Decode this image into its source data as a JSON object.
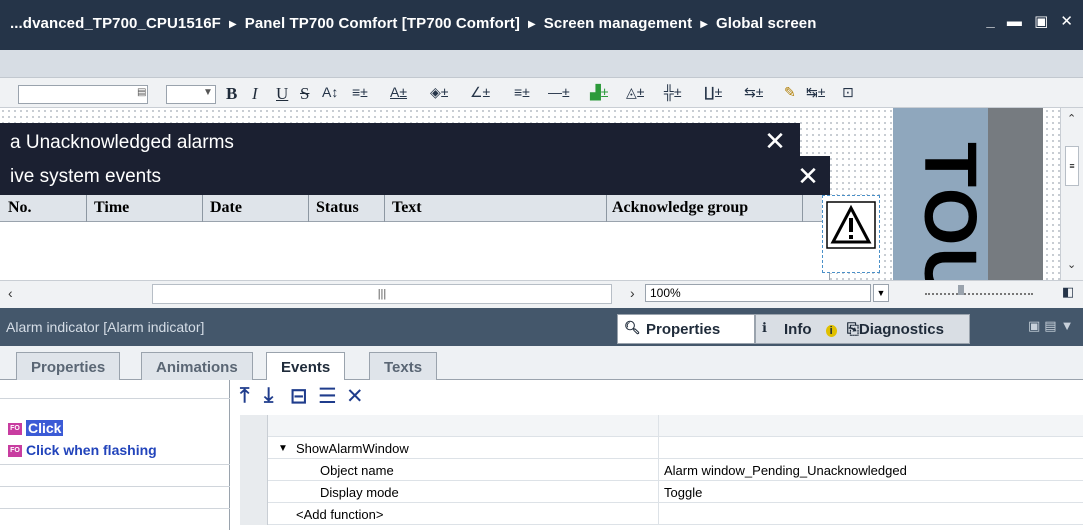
{
  "title_bar": {
    "crumbs": [
      "...dvanced_TP700_CPU1516F",
      "Panel TP700 Comfort [TP700 Comfort]",
      "Screen management",
      "Global screen"
    ],
    "separator": "▶",
    "window_buttons": "_ ▬ ▣ ✕"
  },
  "toolbar": {
    "bold": "B",
    "italic": "I",
    "underline": "U",
    "strike": "S",
    "icons": [
      "font-size-icon",
      "align-icon",
      "text-color-icon",
      "fill-color-icon",
      "line-color-icon",
      "line-style-icon",
      "line-weight-icon",
      "gradient-icon",
      "fill-pattern-icon",
      "distribute-icon",
      "columns-icon",
      "spacing-icon",
      "brush-icon",
      "style-icon",
      "zoom-icon"
    ]
  },
  "alarm_window": {
    "header1": "a Unacknowledged alarms",
    "header2": "ive system events",
    "close": "✕",
    "columns": [
      "No.",
      "Time",
      "Date",
      "Status",
      "Text",
      "Acknowledge group"
    ]
  },
  "touch_text": "TOUC",
  "zoom": {
    "value": "100%"
  },
  "inspector": {
    "title": "Alarm indicator [Alarm indicator]",
    "tabs": [
      {
        "label": "Properties",
        "active": true
      },
      {
        "label": "Info",
        "active": false
      },
      {
        "label": "Diagnostics",
        "active": false
      }
    ]
  },
  "subtabs": [
    {
      "label": "Properties",
      "active": false
    },
    {
      "label": "Animations",
      "active": false
    },
    {
      "label": "Events",
      "active": true
    },
    {
      "label": "Texts",
      "active": false
    }
  ],
  "events": [
    {
      "label": "Click",
      "selected": true
    },
    {
      "label": "Click when flashing",
      "selected": false
    }
  ],
  "function_list": {
    "function": "ShowAlarmWindow",
    "params": [
      {
        "name": "Object name",
        "value": "Alarm window_Pending_Unacknowledged"
      },
      {
        "name": "Display mode",
        "value": "Toggle"
      }
    ],
    "add": "<Add function>"
  },
  "colors": {
    "titlebar": "#253448",
    "alarm_header": "#1b2031",
    "link": "#2244bb",
    "selection": "#3b5bd6"
  }
}
